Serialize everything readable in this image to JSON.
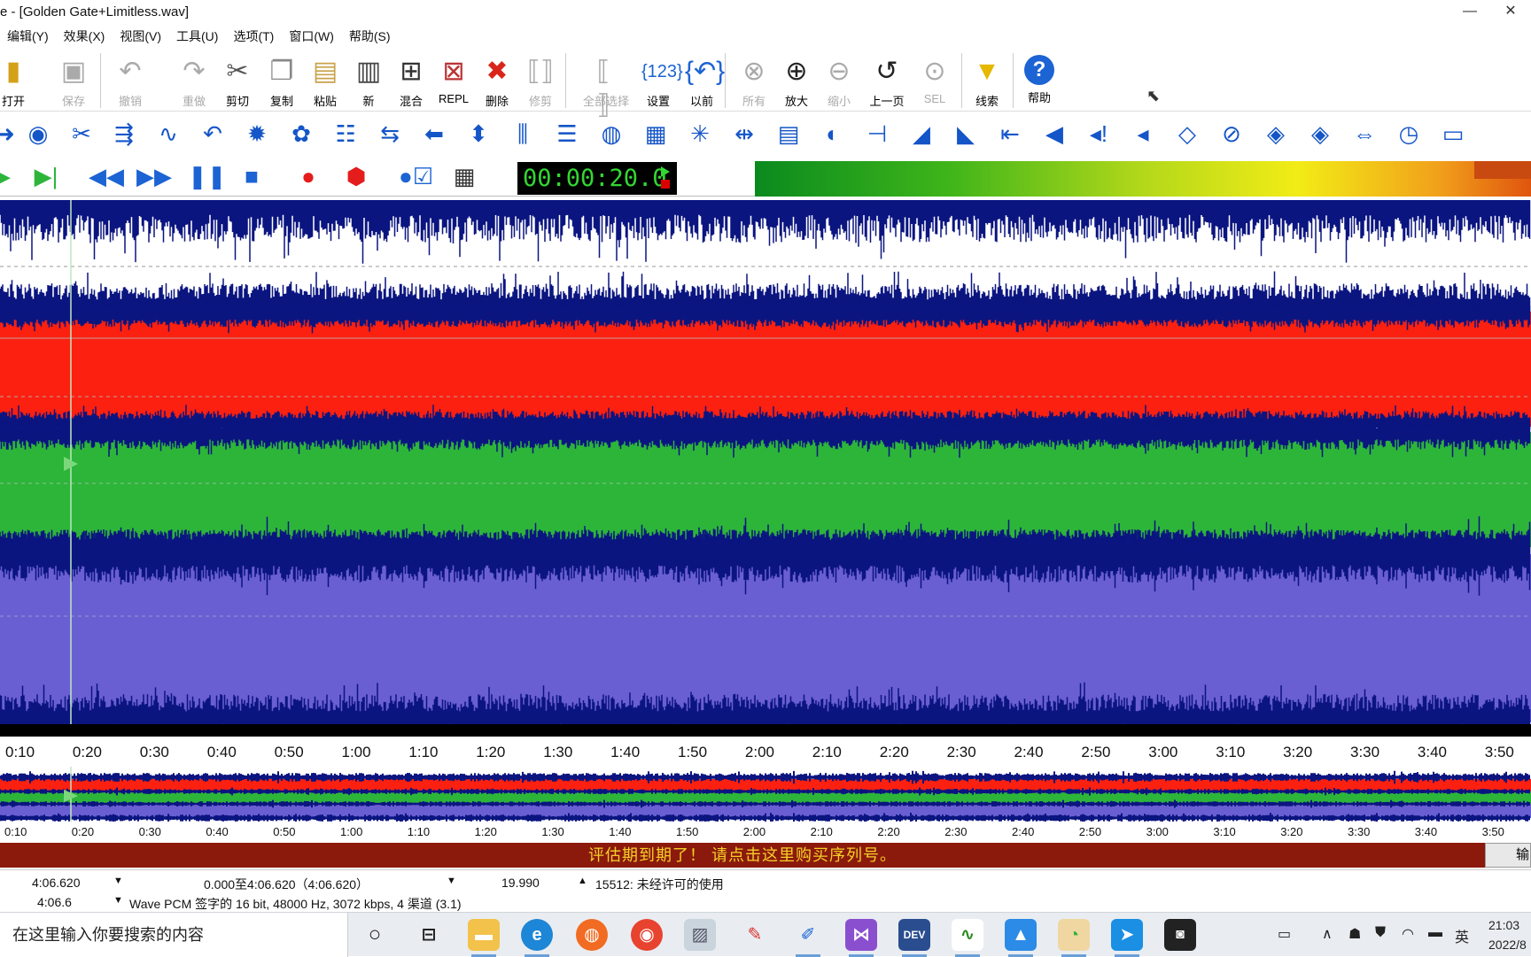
{
  "window": {
    "title": "e - [Golden Gate+Limitless.wav]",
    "minimize_glyph": "—",
    "close_glyph": "✕"
  },
  "menu": [
    "编辑(Y)",
    "效果(X)",
    "视图(V)",
    "工具(U)",
    "选项(T)",
    "窗口(W)",
    "帮助(S)"
  ],
  "toolbar": [
    {
      "label": "打开",
      "icon": "open-icon",
      "enabled": true
    },
    {
      "label": "保存",
      "icon": "save-icon",
      "enabled": false
    },
    {
      "label": "撤销",
      "icon": "undo-icon",
      "enabled": false
    },
    {
      "label": "重做",
      "icon": "redo-icon",
      "enabled": false
    },
    {
      "label": "剪切",
      "icon": "scissors-icon",
      "enabled": true
    },
    {
      "label": "复制",
      "icon": "copy-icon",
      "enabled": true
    },
    {
      "label": "粘贴",
      "icon": "paste-icon",
      "enabled": true
    },
    {
      "label": "新",
      "icon": "new-file-icon",
      "enabled": true
    },
    {
      "label": "混合",
      "icon": "mix-paste-icon",
      "enabled": true
    },
    {
      "label": "REPL",
      "icon": "replace-paste-icon",
      "enabled": true
    },
    {
      "label": "删除",
      "icon": "delete-x-icon",
      "enabled": true
    },
    {
      "label": "修剪",
      "icon": "trim-icon",
      "enabled": false
    },
    {
      "label": "全部选择",
      "icon": "select-all-icon",
      "enabled": false
    },
    {
      "label": "设置",
      "icon": "set-selection-icon",
      "enabled": true
    },
    {
      "label": "以前",
      "icon": "previous-selection-icon",
      "enabled": true
    },
    {
      "label": "所有",
      "icon": "zoom-all-icon",
      "enabled": false
    },
    {
      "label": "放大",
      "icon": "zoom-in-icon",
      "enabled": true
    },
    {
      "label": "缩小",
      "icon": "zoom-out-icon",
      "enabled": false
    },
    {
      "label": "上一页",
      "icon": "zoom-previous-icon",
      "enabled": true
    },
    {
      "label": "SEL",
      "icon": "zoom-selection-icon",
      "enabled": false
    },
    {
      "label": "线索",
      "icon": "cue-marker-icon",
      "enabled": true
    },
    {
      "label": "帮助",
      "icon": "help-icon",
      "enabled": true
    }
  ],
  "transport": {
    "time": "00:00:20.0"
  },
  "colors": {
    "wave_dark": "#0b1580",
    "ch1_fill": "#fb2010",
    "ch2_fill": "#2db53a",
    "ch3_fill": "#6a5fd2",
    "banner_bg": "#8b1a0c",
    "banner_fg": "#f5d028"
  },
  "timeline": [
    "0:10",
    "0:20",
    "0:30",
    "0:40",
    "0:50",
    "1:00",
    "1:10",
    "1:20",
    "1:30",
    "1:40",
    "1:50",
    "2:00",
    "2:10",
    "2:20",
    "2:30",
    "2:40",
    "2:50",
    "3:00",
    "3:10",
    "3:20",
    "3:30",
    "3:40",
    "3:50"
  ],
  "banner": {
    "text": "评估期到期了！ 请点击这里购买序列号。",
    "button": "输"
  },
  "status": {
    "length": "4:06.620",
    "selection": "0.000至4:06.620（4:06.620）",
    "position": "19.990",
    "message": "15512: 未经许可的使用",
    "view_length": "4:06.6",
    "format": "Wave PCM 签字的 16 bit, 48000 Hz, 3072 kbps, 4 渠道 (3.1)"
  },
  "taskbar": {
    "search_placeholder": "在这里输入你要搜索的内容",
    "ime": "英",
    "time": "21:03",
    "date": "2022/8"
  }
}
